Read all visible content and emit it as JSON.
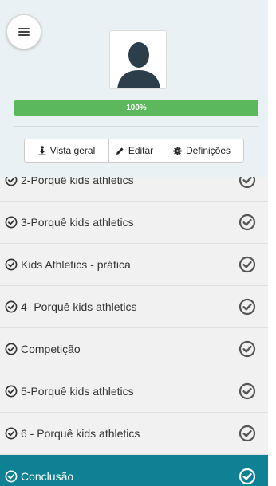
{
  "header": {
    "menu_icon": "hamburger-icon",
    "avatar_icon": "user-silhouette-icon",
    "progress": {
      "value": 100,
      "label": "100%",
      "color": "#5cb85c"
    }
  },
  "toolbar": {
    "overview": {
      "label": "Vista geral",
      "icon": "download-person-icon"
    },
    "edit": {
      "label": "Editar",
      "icon": "pencil-icon"
    },
    "settings": {
      "label": "Definições",
      "icon": "gear-icon"
    }
  },
  "lessons": [
    {
      "title": "2-Porquê kids athletics",
      "completed": true,
      "active": false
    },
    {
      "title": "3-Porquê kids athletics",
      "completed": true,
      "active": false
    },
    {
      "title": "Kids Athletics - prática",
      "completed": true,
      "active": false
    },
    {
      "title": "4- Porquê kids athletics",
      "completed": true,
      "active": false
    },
    {
      "title": "Competição",
      "completed": true,
      "active": false
    },
    {
      "title": "5-Porquê kids athletics",
      "completed": true,
      "active": false
    },
    {
      "title": "6 - Porquê kids athletics",
      "completed": true,
      "active": false
    },
    {
      "title": "Conclusão",
      "completed": true,
      "active": true
    }
  ],
  "colors": {
    "accent": "#0e8294",
    "progress": "#5cb85c",
    "panel": "#e9f1f4",
    "list": "#f1f1f1"
  }
}
